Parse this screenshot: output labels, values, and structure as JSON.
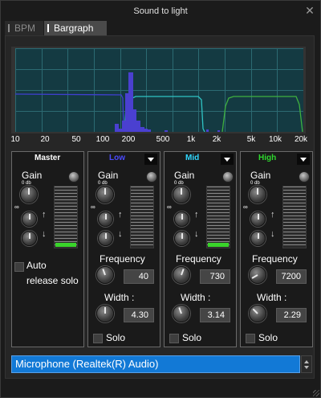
{
  "window": {
    "title": "Sound to light",
    "close_icon": "close-icon"
  },
  "tabs": [
    {
      "label": "BPM",
      "active": false
    },
    {
      "label": "Bargraph",
      "active": true
    }
  ],
  "spectrum": {
    "x_ticks": [
      "10",
      "20",
      "50",
      "100",
      "200",
      "500",
      "1k",
      "2k",
      "5k",
      "10k",
      "20k"
    ],
    "colors": {
      "low": "#3f3fcf",
      "mid": "#2fc4c4",
      "high": "#3fb03f",
      "bars": "#4a40d0",
      "grid": "#2c6a72",
      "bg": "#143a42"
    }
  },
  "bands": {
    "master": {
      "name": "Master",
      "gain_label": "Gain",
      "gain_db_label": "0 db",
      "infinity_label": "∞",
      "meter_level": 0.06,
      "auto_release_label": "Auto",
      "auto_release_label2": "release solo"
    },
    "low": {
      "name": "Low",
      "name_color": "#4a4aff",
      "gain_label": "Gain",
      "gain_db_label": "0 db",
      "infinity_label": "∞",
      "meter_level": 0.0,
      "frequency_label": "Frequency",
      "frequency_value": "40",
      "width_label": "Width :",
      "width_value": "4.30",
      "solo_label": "Solo"
    },
    "mid": {
      "name": "Mid",
      "name_color": "#2fd8ff",
      "gain_label": "Gain",
      "gain_db_label": "0 db",
      "infinity_label": "∞",
      "meter_level": 0.06,
      "frequency_label": "Frequency",
      "frequency_value": "730",
      "width_label": "Width :",
      "width_value": "3.14",
      "solo_label": "Solo"
    },
    "high": {
      "name": "High",
      "name_color": "#2ed82e",
      "gain_label": "Gain",
      "gain_db_label": "0 db",
      "infinity_label": "∞",
      "meter_level": 0.0,
      "frequency_label": "Frequency",
      "frequency_value": "7200",
      "width_label": "Width :",
      "width_value": "2.29",
      "solo_label": "Solo"
    }
  },
  "input_device": {
    "value": "Microphone (Realtek(R) Audio)"
  }
}
